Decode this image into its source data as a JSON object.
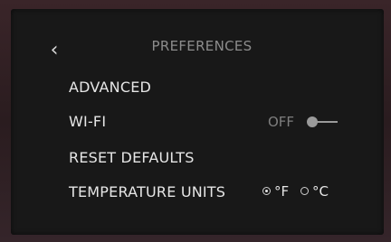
{
  "header": {
    "title": "PREFERENCES",
    "back_icon": "chevron-left-icon"
  },
  "menu": {
    "advanced_label": "ADVANCED",
    "wifi_label": "WI-FI",
    "wifi_state": "OFF",
    "wifi_enabled": false,
    "reset_label": "RESET DEFAULTS",
    "temperature_label": "TEMPERATURE UNITS",
    "temperature_options": [
      {
        "label": "°F",
        "selected": true
      },
      {
        "label": "°C",
        "selected": false
      }
    ]
  }
}
